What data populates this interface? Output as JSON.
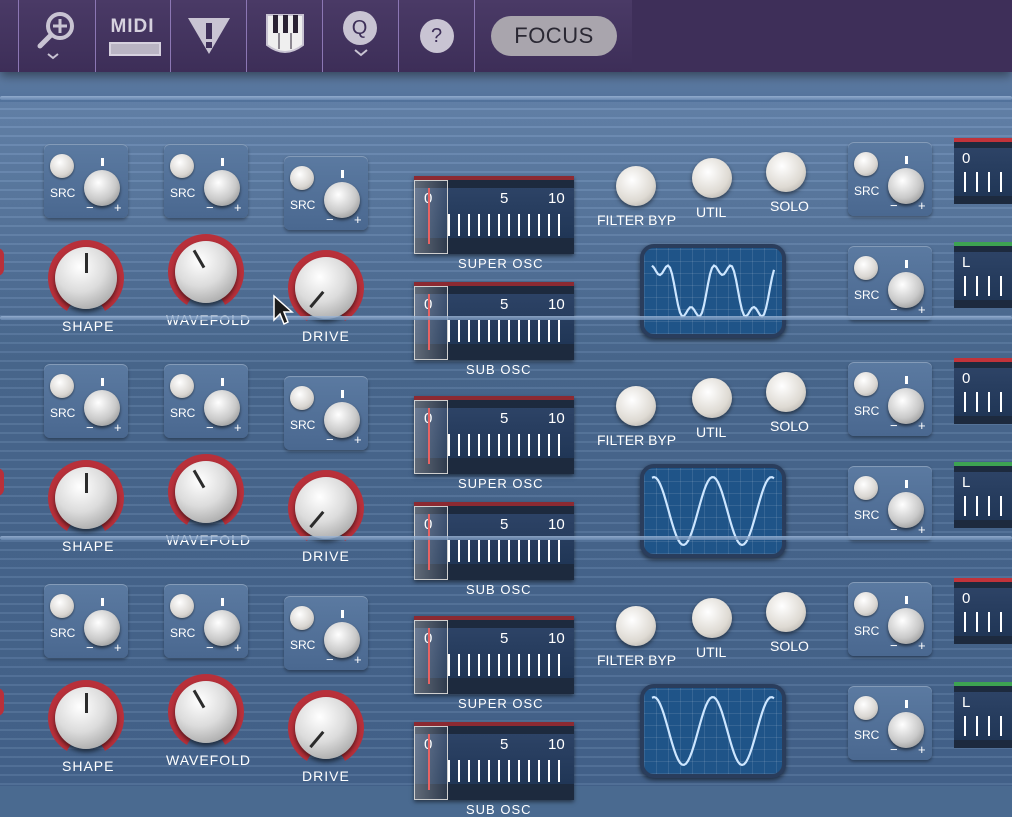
{
  "toolbar": {
    "focus_label": "FOCUS",
    "midi_label": "MIDI",
    "q_label": "Q",
    "help_label": "?",
    "icons": [
      "zoom-icon",
      "midi-icon",
      "warning-icon",
      "keyboard-icon",
      "q-icon",
      "help-icon"
    ]
  },
  "lanes": [
    {
      "src_label": "SRC",
      "knob_labels": {
        "shape": "SHAPE",
        "wavefold": "WAVEFOLD",
        "drive": "DRIVE"
      },
      "meters": {
        "super": "SUPER OSC",
        "sub": "SUB OSC"
      },
      "scale": {
        "a": "0",
        "b": "5",
        "c": "10"
      },
      "buttons": {
        "filter": "FILTER BYP",
        "util": "UTIL",
        "solo": "SOLO"
      },
      "right": {
        "top_num": "0",
        "bottom_num": "L"
      }
    },
    {
      "src_label": "SRC",
      "knob_labels": {
        "shape": "SHAPE",
        "wavefold": "WAVEFOLD",
        "drive": "DRIVE"
      },
      "meters": {
        "super": "SUPER OSC",
        "sub": "SUB OSC"
      },
      "scale": {
        "a": "0",
        "b": "5",
        "c": "10"
      },
      "buttons": {
        "filter": "FILTER BYP",
        "util": "UTIL",
        "solo": "SOLO"
      },
      "right": {
        "top_num": "0",
        "bottom_num": "L"
      }
    },
    {
      "src_label": "SRC",
      "knob_labels": {
        "shape": "SHAPE",
        "wavefold": "WAVEFOLD",
        "drive": "DRIVE"
      },
      "meters": {
        "super": "SUPER OSC",
        "sub": "SUB OSC"
      },
      "scale": {
        "a": "0",
        "b": "5",
        "c": "10"
      },
      "buttons": {
        "filter": "FILTER BYP",
        "util": "UTIL",
        "solo": "SOLO"
      },
      "right": {
        "top_num": "0",
        "bottom_num": "L"
      }
    }
  ],
  "signs": {
    "minus": "−",
    "plus": "+"
  },
  "colors": {
    "accent_red": "#b8303a",
    "scope_blue": "#1f5488",
    "toolbar": "#3e2f59"
  }
}
